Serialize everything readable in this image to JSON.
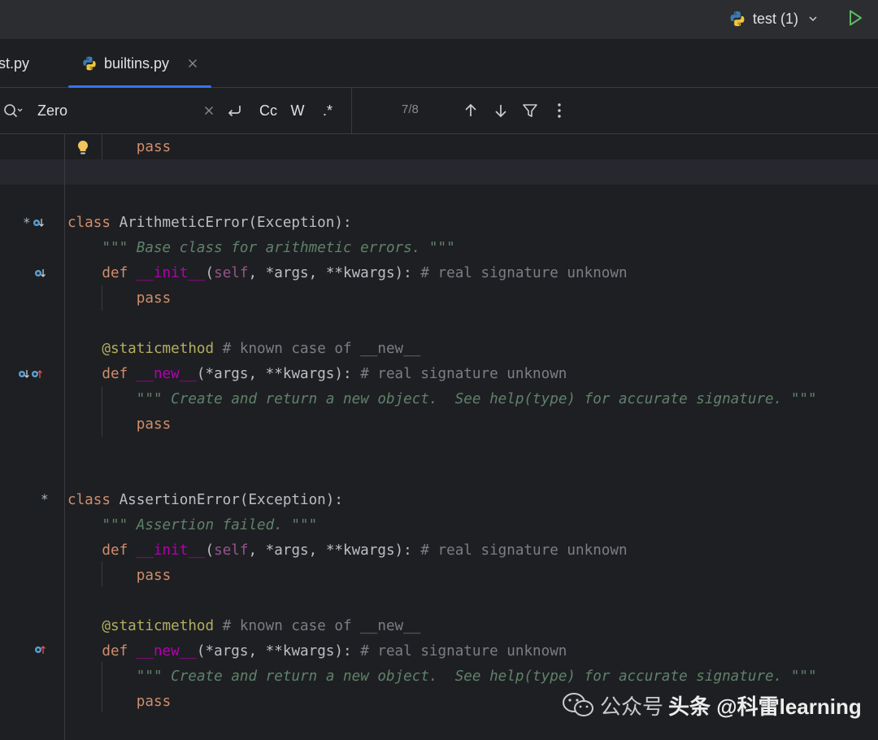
{
  "toolbar": {
    "run_config_label": "test (1)",
    "run_icon": "play-icon"
  },
  "tabs": [
    {
      "label": "st.py",
      "active": false
    },
    {
      "label": "builtins.py",
      "active": true
    }
  ],
  "find": {
    "query": "Zero",
    "match_case_label": "Cc",
    "whole_word_label": "W",
    "regex_label": ".*",
    "count": "7/8"
  },
  "code_lines": [
    {
      "line": 0,
      "parts": [
        {
          "c": "kw",
          "t": "pass"
        }
      ],
      "indent": 4
    },
    {
      "line": 1,
      "parts": [],
      "indent": 0
    },
    {
      "line": 2,
      "parts": [],
      "indent": 0
    },
    {
      "line": 3,
      "parts": [
        {
          "c": "kw",
          "t": "class "
        },
        {
          "c": "plain",
          "t": "ArithmeticError(Exception):"
        }
      ],
      "indent": 0
    },
    {
      "line": 4,
      "parts": [
        {
          "c": "doc",
          "t": "\"\"\" Base class for arithmetic errors. \"\"\""
        }
      ],
      "indent": 2
    },
    {
      "line": 5,
      "parts": [
        {
          "c": "kw",
          "t": "def "
        },
        {
          "c": "dunder",
          "t": "__init__"
        },
        {
          "c": "plain",
          "t": "("
        },
        {
          "c": "self",
          "t": "self"
        },
        {
          "c": "plain",
          "t": ", *args, **kwargs): "
        },
        {
          "c": "cmt",
          "t": "# real signature unknown"
        }
      ],
      "indent": 2
    },
    {
      "line": 6,
      "parts": [
        {
          "c": "kw",
          "t": "pass"
        }
      ],
      "indent": 4
    },
    {
      "line": 7,
      "parts": [],
      "indent": 0
    },
    {
      "line": 8,
      "parts": [
        {
          "c": "deco",
          "t": "@staticmethod"
        },
        {
          "c": "cmt",
          "t": " # known case of __new__"
        }
      ],
      "indent": 2
    },
    {
      "line": 9,
      "parts": [
        {
          "c": "kw",
          "t": "def "
        },
        {
          "c": "dunder",
          "t": "__new__"
        },
        {
          "c": "plain",
          "t": "(*args, **kwargs): "
        },
        {
          "c": "cmt",
          "t": "# real signature unknown"
        }
      ],
      "indent": 2
    },
    {
      "line": 10,
      "parts": [
        {
          "c": "doc",
          "t": "\"\"\" Create and return a new object.  See help(type) for accurate signature. \"\"\""
        }
      ],
      "indent": 4
    },
    {
      "line": 11,
      "parts": [
        {
          "c": "kw",
          "t": "pass"
        }
      ],
      "indent": 4
    },
    {
      "line": 12,
      "parts": [],
      "indent": 0
    },
    {
      "line": 13,
      "parts": [],
      "indent": 0
    },
    {
      "line": 14,
      "parts": [
        {
          "c": "kw",
          "t": "class "
        },
        {
          "c": "plain",
          "t": "AssertionError(Exception):"
        }
      ],
      "indent": 0
    },
    {
      "line": 15,
      "parts": [
        {
          "c": "doc",
          "t": "\"\"\" Assertion failed. \"\"\""
        }
      ],
      "indent": 2
    },
    {
      "line": 16,
      "parts": [
        {
          "c": "kw",
          "t": "def "
        },
        {
          "c": "dunder",
          "t": "__init__"
        },
        {
          "c": "plain",
          "t": "("
        },
        {
          "c": "self",
          "t": "self"
        },
        {
          "c": "plain",
          "t": ", *args, **kwargs): "
        },
        {
          "c": "cmt",
          "t": "# real signature unknown"
        }
      ],
      "indent": 2
    },
    {
      "line": 17,
      "parts": [
        {
          "c": "kw",
          "t": "pass"
        }
      ],
      "indent": 4
    },
    {
      "line": 18,
      "parts": [],
      "indent": 0
    },
    {
      "line": 19,
      "parts": [
        {
          "c": "deco",
          "t": "@staticmethod"
        },
        {
          "c": "cmt",
          "t": " # known case of __new__"
        }
      ],
      "indent": 2
    },
    {
      "line": 20,
      "parts": [
        {
          "c": "kw",
          "t": "def "
        },
        {
          "c": "dunder",
          "t": "__new__"
        },
        {
          "c": "plain",
          "t": "(*args, **kwargs): "
        },
        {
          "c": "cmt",
          "t": "# real signature unknown"
        }
      ],
      "indent": 2
    },
    {
      "line": 21,
      "parts": [
        {
          "c": "doc",
          "t": "\"\"\" Create and return a new object.  See help(type) for accurate signature. \"\"\""
        }
      ],
      "indent": 4
    },
    {
      "line": 22,
      "parts": [
        {
          "c": "kw",
          "t": "pass"
        }
      ],
      "indent": 4
    }
  ],
  "watermark": {
    "text_a": "公众号",
    "text_b": "头条 @科雷learning"
  },
  "colors": {
    "keyword": "#cf8e6d",
    "dunder": "#b200b2",
    "self": "#94558d",
    "decorator": "#b3ae60",
    "comment": "#7a7e85",
    "docstring": "#5f826b",
    "accent": "#3574f0",
    "run_green": "#5fb865"
  }
}
